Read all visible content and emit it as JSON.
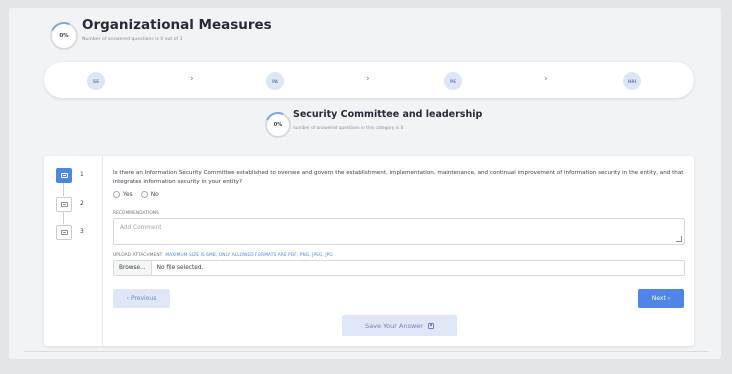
{
  "header": {
    "progress": "0%",
    "title": "Organizational Measures",
    "subtitle": "Number of answered questions is 0 out of 3"
  },
  "steps": [
    {
      "label": "SE"
    },
    {
      "label": "PA"
    },
    {
      "label": "PE"
    },
    {
      "label": "HRI"
    }
  ],
  "step_separator": "›",
  "section": {
    "progress": "0%",
    "title": "Security Committee and leadership",
    "subtitle": "number of answered questions in this category is 0"
  },
  "questions": [
    {
      "number": "1",
      "active": true
    },
    {
      "number": "2",
      "active": false
    },
    {
      "number": "3",
      "active": false
    }
  ],
  "question_text": "Is there an Information Security Committee established to oversee and govern the establishment, implementation, maintenance, and continual improvement of information security in the entity, and that integrates information security in your entity?",
  "options": {
    "yes": "Yes",
    "no": "No"
  },
  "recommendations": {
    "label": "RECOMMENDATIONS",
    "placeholder": "Add Comment"
  },
  "upload": {
    "label": "UPLOAD ATTACHMENT",
    "hint": "MAXIMUM SIZE IS 6MB, ONLY ALLOWED FORMATS ARE PDF, PNG, JPEG, JPG",
    "browse": "Browse...",
    "status": "No file selected."
  },
  "buttons": {
    "previous": "‹  Previous",
    "next": "Next  ›",
    "save": "Save Your Answer"
  },
  "colors": {
    "accent": "#4e85e6",
    "accent_light": "#dfe7f6",
    "background": "#e4e5e9"
  }
}
